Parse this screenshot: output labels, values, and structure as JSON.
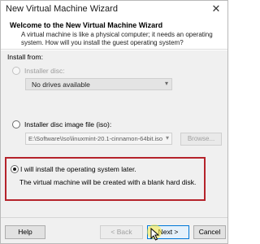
{
  "window": {
    "title": "New Virtual Machine Wizard",
    "close_glyph": "✕"
  },
  "header": {
    "title": "Welcome to the New Virtual Machine Wizard",
    "description": "A virtual machine is like a physical computer; it needs an operating system. How will you install the guest operating system?"
  },
  "install_from": {
    "label": "Install from:",
    "options": [
      {
        "label": "Installer disc:",
        "selected": false,
        "enabled": false
      },
      {
        "label": "Installer disc image file (iso):",
        "selected": false,
        "enabled": true
      },
      {
        "label": "I will install the operating system later.",
        "selected": true,
        "enabled": true
      }
    ],
    "disc_dropdown_value": "No drives available",
    "iso_path_value": "E:\\Software\\Iso\\linuxmint-20.1-cinnamon-64bit.iso",
    "browse_label": "Browse...",
    "later_description": "The virtual machine will be created with a blank hard disk."
  },
  "footer": {
    "help_label": "Help",
    "back_label": "< Back",
    "next_label": "Next >",
    "cancel_label": "Cancel"
  },
  "colors": {
    "highlight_border": "#b5232b",
    "focus_accent": "#0078d7"
  }
}
